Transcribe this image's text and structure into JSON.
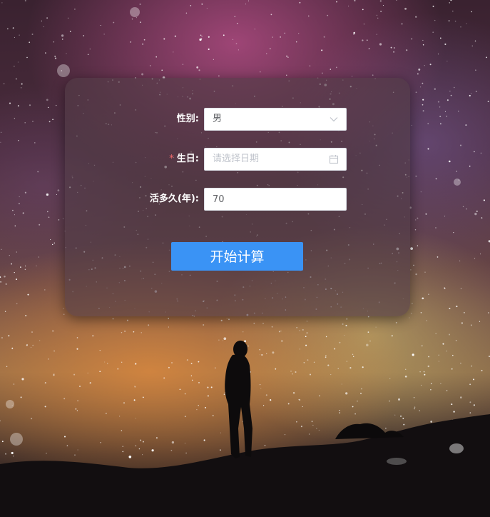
{
  "form": {
    "gender": {
      "label": "性别:",
      "value": "男"
    },
    "birthday": {
      "required_mark": "*",
      "label": "生日:",
      "placeholder": "请选择日期"
    },
    "lifespan": {
      "label": "活多久(年):",
      "value": "70"
    },
    "submit_label": "开始计算"
  },
  "icons": {
    "gender_dropdown": "chevron-down-icon",
    "birthday_picker": "calendar-icon"
  },
  "colors": {
    "primary_button": "#3a93f5",
    "required_mark": "#f56c6c"
  }
}
